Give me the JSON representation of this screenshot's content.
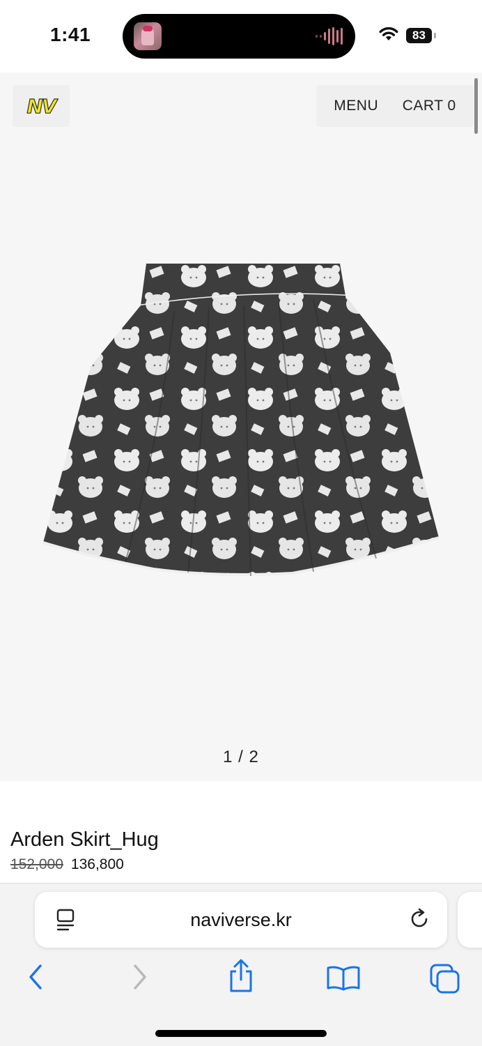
{
  "status_bar": {
    "time": "1:41",
    "battery": "83",
    "wifi_icon": "wifi-icon"
  },
  "header": {
    "logo": "NV",
    "menu_label": "MENU",
    "cart_label": "CART 0"
  },
  "gallery": {
    "counter": "1 / 2"
  },
  "product": {
    "name": "Arden Skirt_Hug",
    "original_price": "152,000",
    "sale_price": "136,800"
  },
  "browser": {
    "url": "naviverse.kr",
    "accent_color": "#1a73e8"
  }
}
